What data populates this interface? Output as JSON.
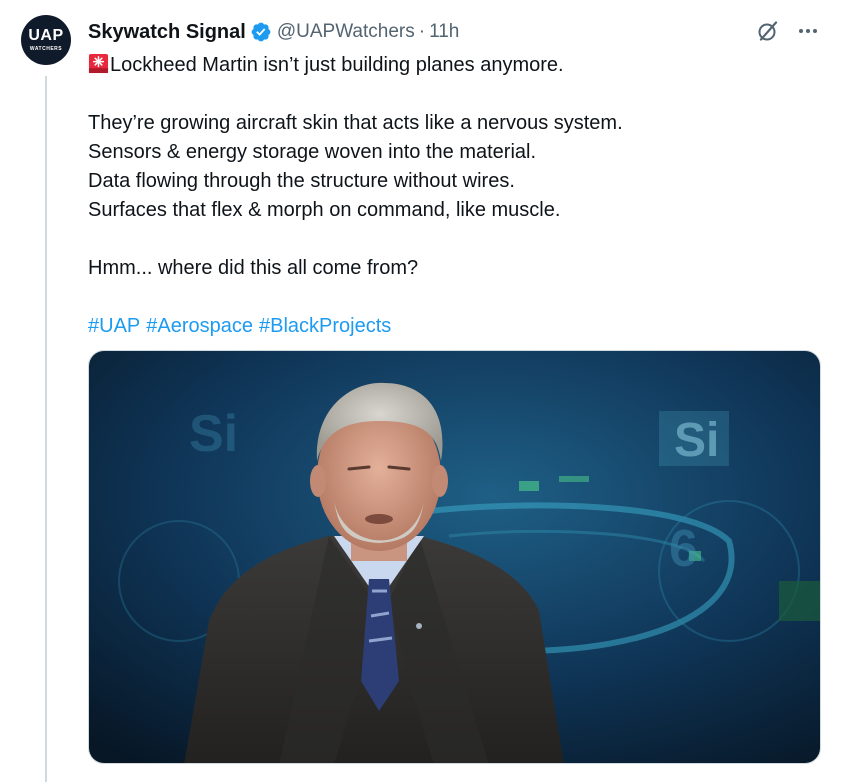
{
  "author": {
    "avatar_text": "UAP",
    "avatar_subtext": "WATCHERS",
    "display_name": "Skywatch Signal",
    "handle": "@UAPWatchers",
    "separator": "·",
    "timestamp": "11h",
    "verified": true
  },
  "actions": {
    "grok_icon": "slash-circle-icon",
    "more_icon": "more-horizontal-icon"
  },
  "tweet": {
    "line_1": "Lockheed Martin isn’t just building planes anymore.",
    "line_2": "They’re growing aircraft skin that acts like a nervous system.",
    "line_3": "Sensors & energy storage woven into the material.",
    "line_4": "Data flowing through the structure without wires.",
    "line_5": "Surfaces that flex & morph on command, like muscle.",
    "line_6": "Hmm... where did this all come from?",
    "hashtags": [
      "#UAP",
      "#Aerospace",
      "#BlackProjects"
    ],
    "lead_icon": "rotating-light-icon"
  },
  "media": {
    "background_text_1": "Si",
    "background_text_2": "Si",
    "background_text_3": "6"
  },
  "colors": {
    "accent": "#1d9bf0",
    "secondary_text": "#536471",
    "verified_badge": "#1d9bf0"
  }
}
